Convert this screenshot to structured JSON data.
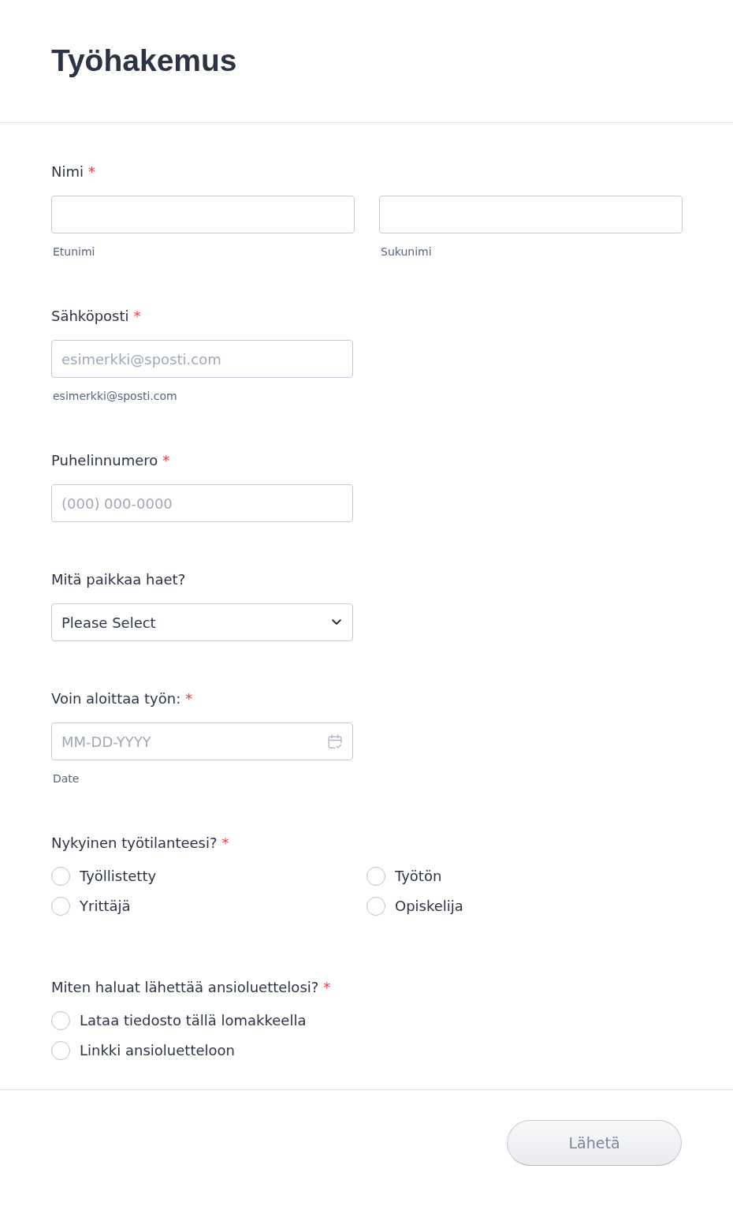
{
  "form": {
    "title": "Työhakemus"
  },
  "fields": [
    {
      "kind": "name",
      "label": "Nimi",
      "required_mark": "*",
      "inputs": [
        {
          "sublabel": "Etunimi"
        },
        {
          "sublabel": "Sukunimi"
        }
      ]
    },
    {
      "kind": "text",
      "label": "Sähköposti",
      "required_mark": "*",
      "placeholder": "esimerkki@sposti.com",
      "sublabel": "esimerkki@sposti.com"
    },
    {
      "kind": "text",
      "label": "Puhelinnumero",
      "required_mark": "*",
      "placeholder": "(000) 000-0000"
    },
    {
      "kind": "select",
      "label": "Mitä paikkaa haet?",
      "value": "Please Select"
    },
    {
      "kind": "date",
      "label": "Voin aloittaa työn:",
      "required_mark": "*",
      "placeholder": "MM-DD-YYYY",
      "sublabel": "Date"
    },
    {
      "kind": "radiogrid",
      "label": "Nykyinen työtilanteesi?",
      "required_mark": "*",
      "options": [
        {
          "label": "Työllistetty",
          "selected": false
        },
        {
          "label": "Työtön",
          "selected": false
        },
        {
          "label": "Yrittäjä",
          "selected": false
        },
        {
          "label": "Opiskelija",
          "selected": false
        }
      ]
    },
    {
      "kind": "radiolist",
      "label": "Miten haluat lähettää ansioluettelosi?",
      "required_mark": "*",
      "options": [
        {
          "label": "Lataa tiedosto tällä lomakkeella",
          "selected": false
        },
        {
          "label": "Linkki ansioluetteloon",
          "selected": false
        }
      ]
    }
  ],
  "footer": {
    "submit_button": "Lähetä"
  }
}
